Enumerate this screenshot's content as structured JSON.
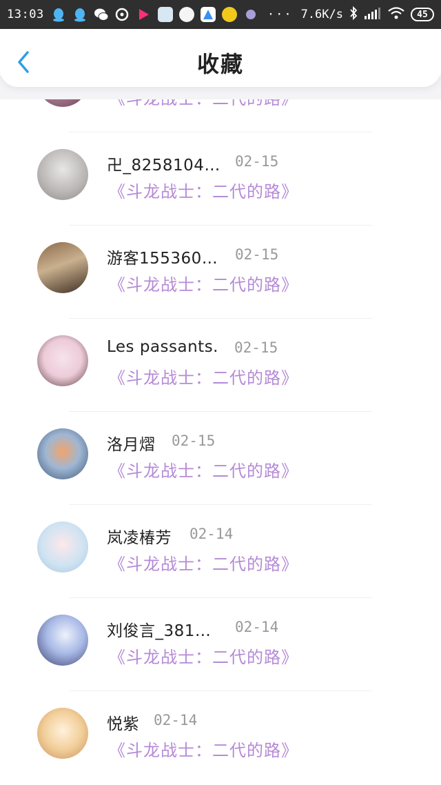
{
  "status_bar": {
    "time": "13:03",
    "dots": "···",
    "net_speed": "7.6K/s",
    "battery": "45"
  },
  "header": {
    "title": "收藏"
  },
  "items": [
    {
      "name": "",
      "date": "",
      "book": "《斗龙战士：二代的路》"
    },
    {
      "name": "卍_8258104…",
      "date": "02-15",
      "book": "《斗龙战士：二代的路》"
    },
    {
      "name": "游客155360…",
      "date": "02-15",
      "book": "《斗龙战士：二代的路》"
    },
    {
      "name": "Les passants.",
      "date": "02-15",
      "book": "《斗龙战士：二代的路》"
    },
    {
      "name": "洛月熠",
      "date": "02-15",
      "book": "《斗龙战士：二代的路》"
    },
    {
      "name": "岚凌椿芳",
      "date": "02-14",
      "book": "《斗龙战士：二代的路》"
    },
    {
      "name": "刘俊言_381…",
      "date": "02-14",
      "book": "《斗龙战士：二代的路》"
    },
    {
      "name": "悦紫",
      "date": "02-14",
      "book": "《斗龙战士：二代的路》"
    }
  ],
  "colors": {
    "accent": "#2f9de8",
    "book_title": "#b58ad6",
    "date": "#999999",
    "status_bar": "#2f2f2f"
  },
  "icons": [
    "back-arrow-icon",
    "qq-icon",
    "wechat-icon",
    "youku-icon",
    "bluetooth-icon",
    "signal-icon",
    "wifi-icon",
    "battery-icon"
  ]
}
